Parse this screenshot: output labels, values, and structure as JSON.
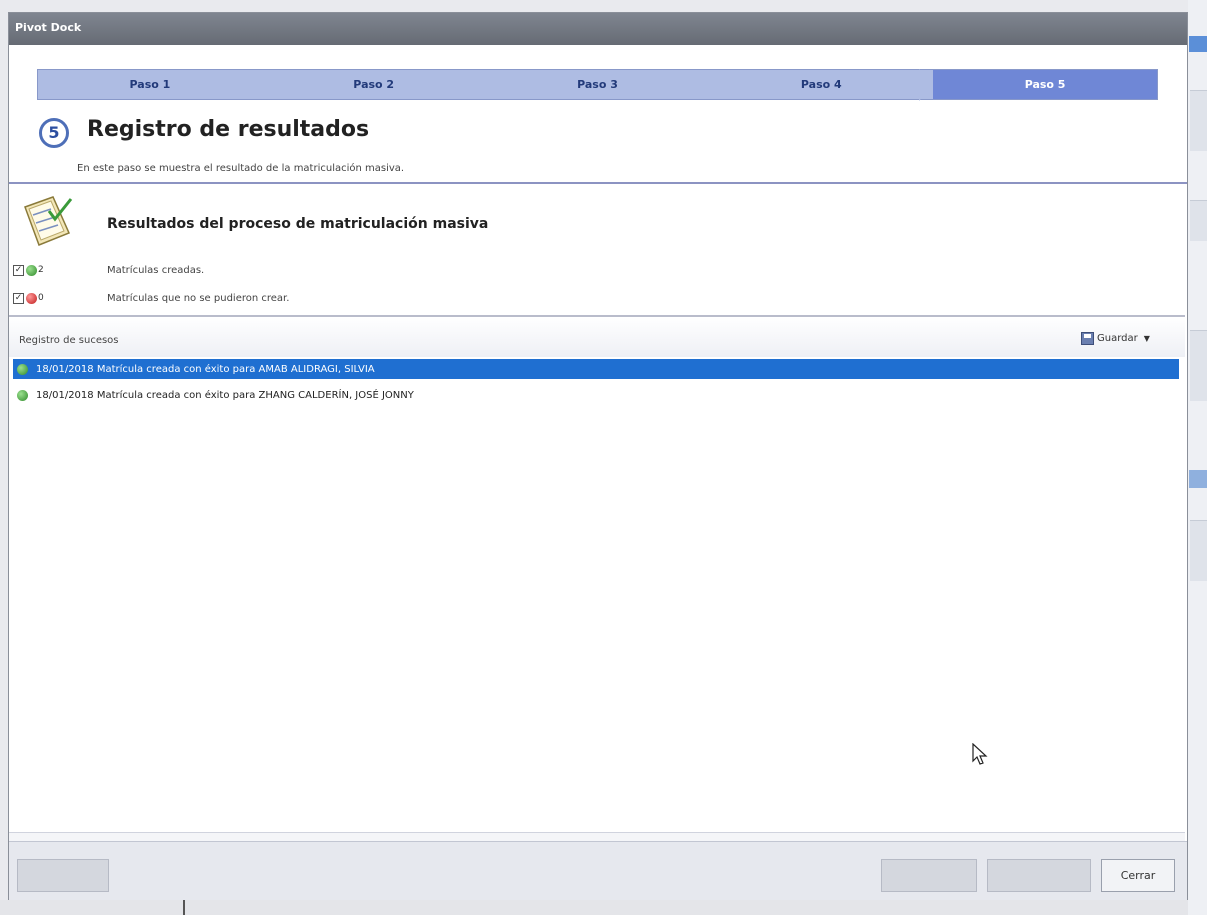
{
  "window": {
    "title": "Pivot Dock"
  },
  "steps": [
    {
      "label": "Paso 1"
    },
    {
      "label": "Paso 2"
    },
    {
      "label": "Paso 3"
    },
    {
      "label": "Paso 4"
    },
    {
      "label": "Paso 5"
    }
  ],
  "active_step": 5,
  "header": {
    "step_number": "5",
    "title": "Registro de resultados",
    "subtitle": "En este paso se muestra el resultado de la matriculación masiva."
  },
  "results": {
    "title": "Resultados del proceso de matriculación masiva",
    "created_count": "2",
    "created_label": "Matrículas creadas.",
    "failed_count": "0",
    "failed_label": "Matrículas que no se pudieron crear."
  },
  "log": {
    "title": "Registro de sucesos",
    "save_label": "Guardar",
    "entries": [
      {
        "text": "18/01/2018 Matrícula creada con éxito para AMAB ALIDRAGI, SILVIA",
        "status": "success",
        "selected": true
      },
      {
        "text": "18/01/2018 Matrícula creada con éxito para ZHANG CALDERÍN, JOSÉ JONNY",
        "status": "success",
        "selected": false
      }
    ]
  },
  "footer": {
    "close_label": "Cerrar"
  },
  "colors": {
    "step_bar": "#aebce3",
    "step_active": "#6f87d6",
    "selection": "#1f6fd1",
    "success": "#2f8a2a",
    "error": "#c01a1a"
  }
}
